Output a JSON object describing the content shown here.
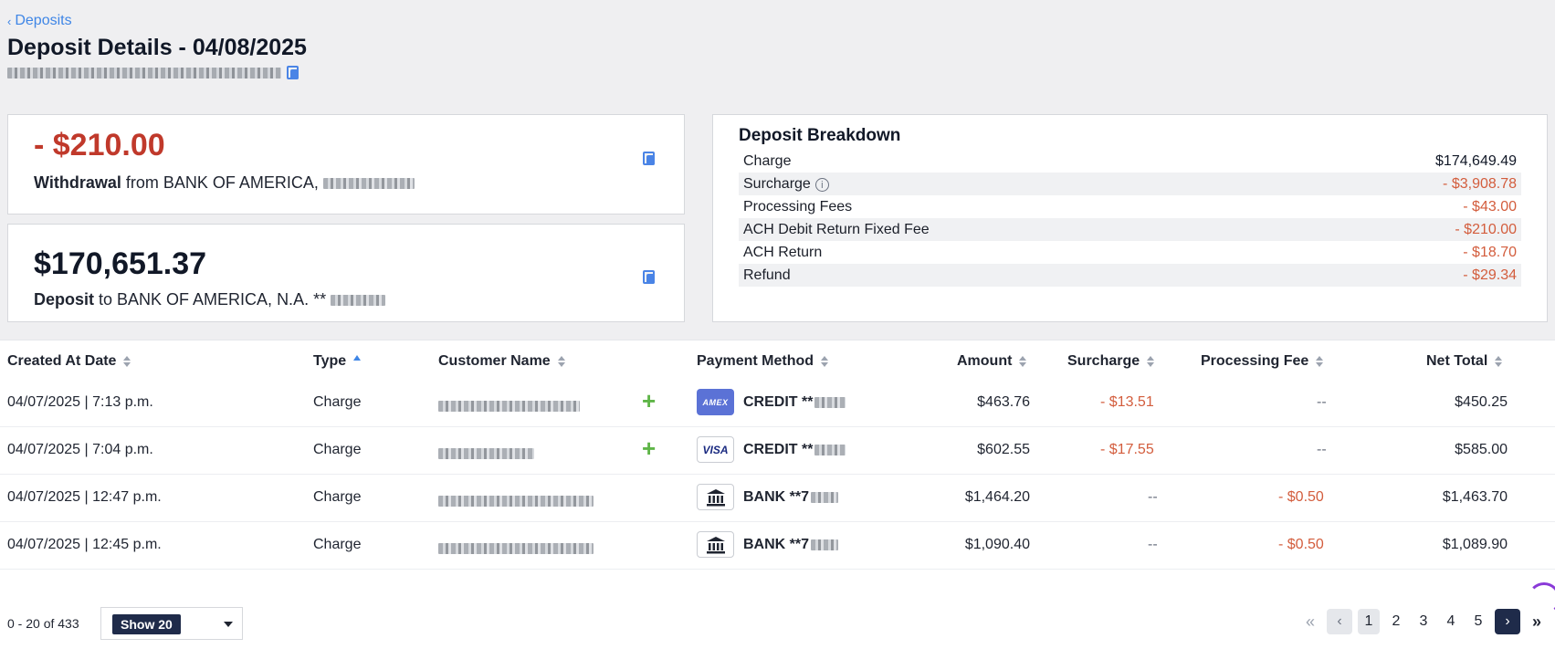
{
  "header": {
    "back_label": "Deposits",
    "title": "Deposit Details - 04/08/2025"
  },
  "withdrawal": {
    "amount": "- $210.00",
    "label": "Withdrawal",
    "text": "from BANK OF AMERICA,"
  },
  "deposit": {
    "amount": "$170,651.37",
    "label": "Deposit",
    "text": "to BANK OF AMERICA, N.A. **"
  },
  "breakdown": {
    "title": "Deposit Breakdown",
    "rows": [
      {
        "label": "Charge",
        "value": "$174,649.49",
        "kind": "pos"
      },
      {
        "label": "Surcharge",
        "value": "- $3,908.78",
        "kind": "neg",
        "info": "i"
      },
      {
        "label": "Processing Fees",
        "value": "- $43.00",
        "kind": "neg"
      },
      {
        "label": "ACH Debit Return Fixed Fee",
        "value": "- $210.00",
        "kind": "neg"
      },
      {
        "label": "ACH Return",
        "value": "- $18.70",
        "kind": "neg"
      },
      {
        "label": "Refund",
        "value": "- $29.34",
        "kind": "neg"
      }
    ]
  },
  "table": {
    "columns": {
      "created": "Created At Date",
      "type": "Type",
      "customer": "Customer Name",
      "payment": "Payment Method",
      "amount": "Amount",
      "surcharge": "Surcharge",
      "fee": "Processing Fee",
      "net": "Net Total"
    },
    "rows": [
      {
        "created": "04/07/2025 | 7:13 p.m.",
        "type": "Charge",
        "pm_badge": "AMEX",
        "pm_text": "CREDIT **",
        "amount": "$463.76",
        "surcharge": "- $13.51",
        "fee": "--",
        "net": "$450.25"
      },
      {
        "created": "04/07/2025 | 7:04 p.m.",
        "type": "Charge",
        "pm_badge": "VISA",
        "pm_text": "CREDIT **",
        "amount": "$602.55",
        "surcharge": "- $17.55",
        "fee": "--",
        "net": "$585.00"
      },
      {
        "created": "04/07/2025 | 12:47 p.m.",
        "type": "Charge",
        "pm_badge": "bank-icon",
        "pm_text": "BANK **7",
        "amount": "$1,464.20",
        "surcharge": "--",
        "fee": "- $0.50",
        "net": "$1,463.70"
      },
      {
        "created": "04/07/2025 | 12:45 p.m.",
        "type": "Charge",
        "pm_badge": "bank-icon",
        "pm_text": "BANK **7",
        "amount": "$1,090.40",
        "surcharge": "--",
        "fee": "- $0.50",
        "net": "$1,089.90"
      }
    ]
  },
  "footer": {
    "range": "0 - 20 of 433",
    "show": "Show 20",
    "pages": [
      "1",
      "2",
      "3",
      "4",
      "5"
    ],
    "first_glyph": "«",
    "prev_glyph": "‹",
    "next_glyph": "›",
    "last_glyph": "»"
  },
  "colors": {
    "accent": "#3f86e6",
    "negative": "#c0392b",
    "navy": "#1f2b4a",
    "add_green": "#5fb548"
  }
}
